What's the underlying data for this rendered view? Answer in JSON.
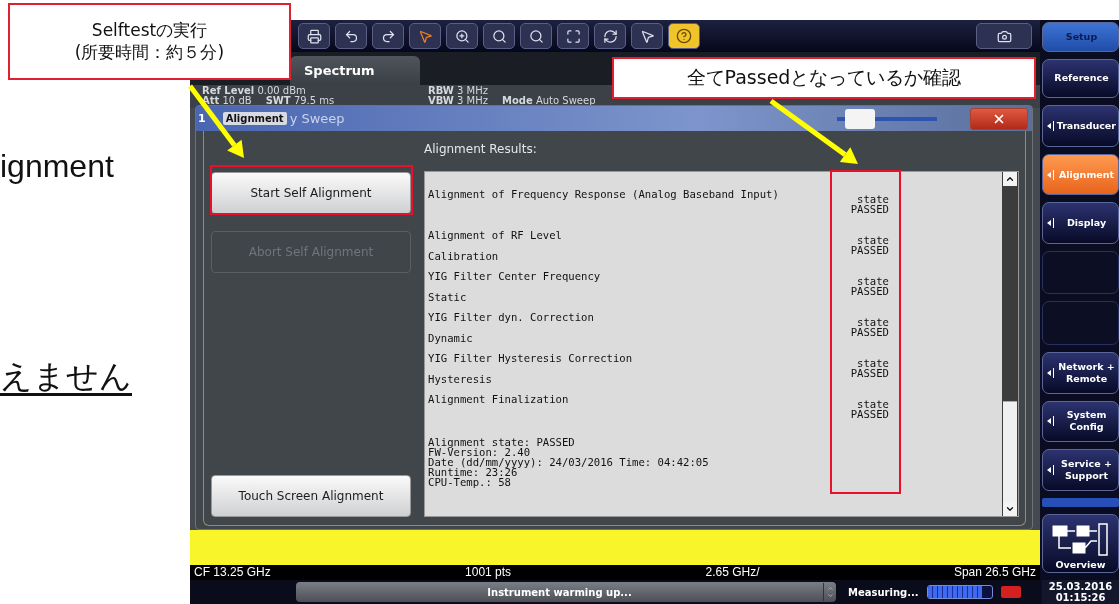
{
  "slide": {
    "fragments": [
      {
        "text": "ignment",
        "underlined": false
      },
      {
        "text": "えません",
        "underlined": true
      }
    ]
  },
  "callouts": [
    {
      "lines": [
        "Selftestの実行",
        "(所要時間：約５分)"
      ]
    },
    {
      "lines": [
        "全てPassedとなっているか確認"
      ]
    }
  ],
  "toolbar": {
    "help_highlighted": true
  },
  "tab": {
    "label": "Spectrum",
    "selected": true
  },
  "settings_columns": [
    {
      "rows": [
        [
          {
            "label": "Ref Level",
            "value": "0.00 dBm"
          }
        ],
        [
          {
            "label": "Att",
            "value": "10 dB"
          },
          {
            "label": "SWT",
            "value": "79.5 ms"
          }
        ]
      ]
    },
    {
      "rows": [
        [
          {
            "label": "RBW",
            "value": "3 MHz"
          }
        ],
        [
          {
            "label": "VBW",
            "value": "3 MHz"
          },
          {
            "label": "Mode",
            "value": "Auto Sweep"
          }
        ]
      ]
    }
  ],
  "dialog": {
    "title": "Alignment",
    "trace_number": "1",
    "trace_title": "y Sweep",
    "transparency": {
      "level": 0.12
    },
    "buttons": [
      {
        "label": "Start Self Alignment",
        "disabled": false
      },
      {
        "label": "Abort Self Alignment",
        "disabled": true
      },
      {
        "label": "Touch Screen Alignment",
        "disabled": false
      }
    ],
    "results_heading": "Alignment Results:",
    "results": [
      {
        "lines": [
          "Alignment of Frequency Response (Analog Baseband Input)"
        ],
        "state_label": "state",
        "state": "PASSED"
      },
      {
        "lines": [
          "Alignment of RF Level",
          "Calibration"
        ],
        "state_label": "state",
        "state": "PASSED"
      },
      {
        "lines": [
          "YIG Filter Center Frequency",
          "Static"
        ],
        "state_label": "state",
        "state": "PASSED"
      },
      {
        "lines": [
          "YIG Filter dyn. Correction",
          "Dynamic"
        ],
        "state_label": "state",
        "state": "PASSED"
      },
      {
        "lines": [
          "YIG Filter Hysteresis Correction",
          "Hysteresis"
        ],
        "state_label": "state",
        "state": "PASSED"
      },
      {
        "lines": [
          "Alignment Finalization"
        ],
        "state_label": "state",
        "state": "PASSED"
      }
    ],
    "summary": [
      "Alignment state: PASSED",
      "FW-Version: 2.40",
      "Date (dd/mm/yyyy): 24/03/2016 Time: 04:42:05",
      "Runtime: 23:26",
      "CPU-Temp.: 58"
    ]
  },
  "status_line": [
    "CF 13.25 GHz",
    "1001 pts",
    "2.65 GHz/",
    "Span 26.5 GHz"
  ],
  "bottom_bar": {
    "message": "Instrument warming up...",
    "status": "Measuring...",
    "progress": {
      "level": 0.85
    }
  },
  "sidebar": [
    {
      "kind": "key",
      "label": "Setup",
      "selected": true
    },
    {
      "kind": "key",
      "label": "Reference",
      "selected": false
    },
    {
      "kind": "menu",
      "label": "Transducer",
      "selected": false
    },
    {
      "kind": "menu",
      "label": "Alignment",
      "selected": true
    },
    {
      "kind": "menu",
      "label": "Display",
      "selected": false
    },
    {
      "kind": "blank"
    },
    {
      "kind": "blank"
    },
    {
      "kind": "menu",
      "label": "Network + Remote",
      "selected": false
    },
    {
      "kind": "menu",
      "label": "System Config",
      "selected": false
    },
    {
      "kind": "menu",
      "label": "Service + Support",
      "selected": false
    },
    {
      "kind": "bar"
    },
    {
      "kind": "overview",
      "label": "Overview",
      "selected": false
    }
  ],
  "datetime": [
    "25.03.2016",
    "01:15:26"
  ]
}
